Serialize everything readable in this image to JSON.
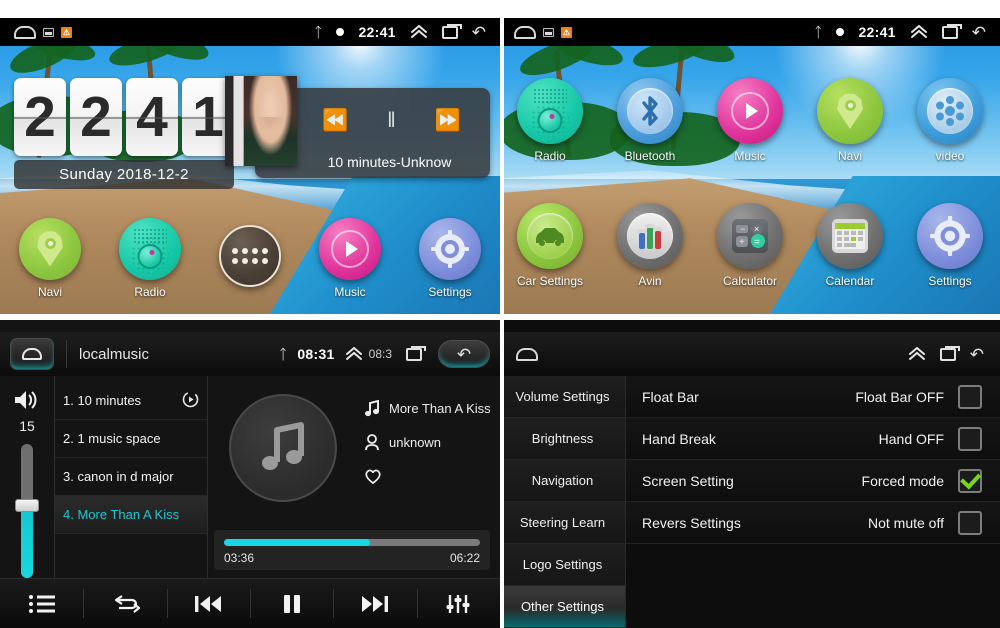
{
  "home": {
    "statusbar": {
      "time": "22:41",
      "icons": [
        "home-icon",
        "sd-badge-icon",
        "warning-badge-icon",
        "bluetooth-icon",
        "dot-icon",
        "chevron-up-icon",
        "recents-icon",
        "back-icon"
      ]
    },
    "clock": {
      "digits": [
        "2",
        "2",
        "4",
        "1"
      ],
      "date": "Sunday  2018-12-2"
    },
    "music_widget": {
      "title": "10 minutes-Unknow",
      "prev": "⏪",
      "pause": "‖",
      "next": "⏩"
    },
    "dock": [
      {
        "label": "Navi",
        "icon": "navi-icon"
      },
      {
        "label": "Radio",
        "icon": "radio-icon"
      },
      {
        "label": "",
        "icon": "app-drawer-icon"
      },
      {
        "label": "Music",
        "icon": "music-icon"
      },
      {
        "label": "Settings",
        "icon": "settings-icon"
      }
    ]
  },
  "apps": {
    "statusbar": {
      "time": "22:41"
    },
    "items": [
      {
        "label": "Radio",
        "icon": "radio-icon"
      },
      {
        "label": "Bluetooth",
        "icon": "bluetooth-icon"
      },
      {
        "label": "Music",
        "icon": "music-icon"
      },
      {
        "label": "Navi",
        "icon": "navi-icon"
      },
      {
        "label": "video",
        "icon": "video-icon"
      },
      {
        "label": "Car Settings",
        "icon": "car-icon"
      },
      {
        "label": "Avin",
        "icon": "avin-icon"
      },
      {
        "label": "Calculator",
        "icon": "calculator-icon"
      },
      {
        "label": "Calendar",
        "icon": "calendar-icon"
      },
      {
        "label": "Settings",
        "icon": "settings-icon"
      }
    ]
  },
  "player": {
    "title": "localmusic",
    "statusbar": {
      "time": "08:31",
      "ghost_time": "08:3"
    },
    "volume": {
      "value": "15",
      "percent": 52
    },
    "playlist": [
      {
        "label": "1. 10 minutes",
        "active": false
      },
      {
        "label": "2. 1 music space",
        "active": false
      },
      {
        "label": "3. canon in d major",
        "active": false
      },
      {
        "label": "4. More Than A Kiss",
        "active": true
      }
    ],
    "now_playing": {
      "track": "More Than A Kiss",
      "artist": "unknown",
      "favorite": false
    },
    "progress": {
      "elapsed": "03:36",
      "total": "06:22",
      "percent": 57
    },
    "controls": [
      "list-icon",
      "repeat-icon",
      "previous-icon",
      "pause-icon",
      "next-icon",
      "equalizer-icon"
    ]
  },
  "settings": {
    "sidebar": [
      {
        "label": "Volume Settings",
        "active": false
      },
      {
        "label": "Brightness",
        "active": false
      },
      {
        "label": "Navigation",
        "active": false
      },
      {
        "label": "Steering Learn",
        "active": false
      },
      {
        "label": "Logo Settings",
        "active": false
      },
      {
        "label": "Other Settings",
        "active": true
      }
    ],
    "rows": [
      {
        "label": "Float Bar",
        "value": "Float Bar OFF",
        "checked": false
      },
      {
        "label": "Hand Break",
        "value": "Hand OFF",
        "checked": false
      },
      {
        "label": "Screen Setting",
        "value": "Forced mode",
        "checked": true
      },
      {
        "label": "Revers Settings",
        "value": "Not mute off",
        "checked": false
      }
    ]
  },
  "colors": {
    "accent_teal": "#17d7e2",
    "accent_green": "#7ed321",
    "status_bg": "#000000"
  }
}
